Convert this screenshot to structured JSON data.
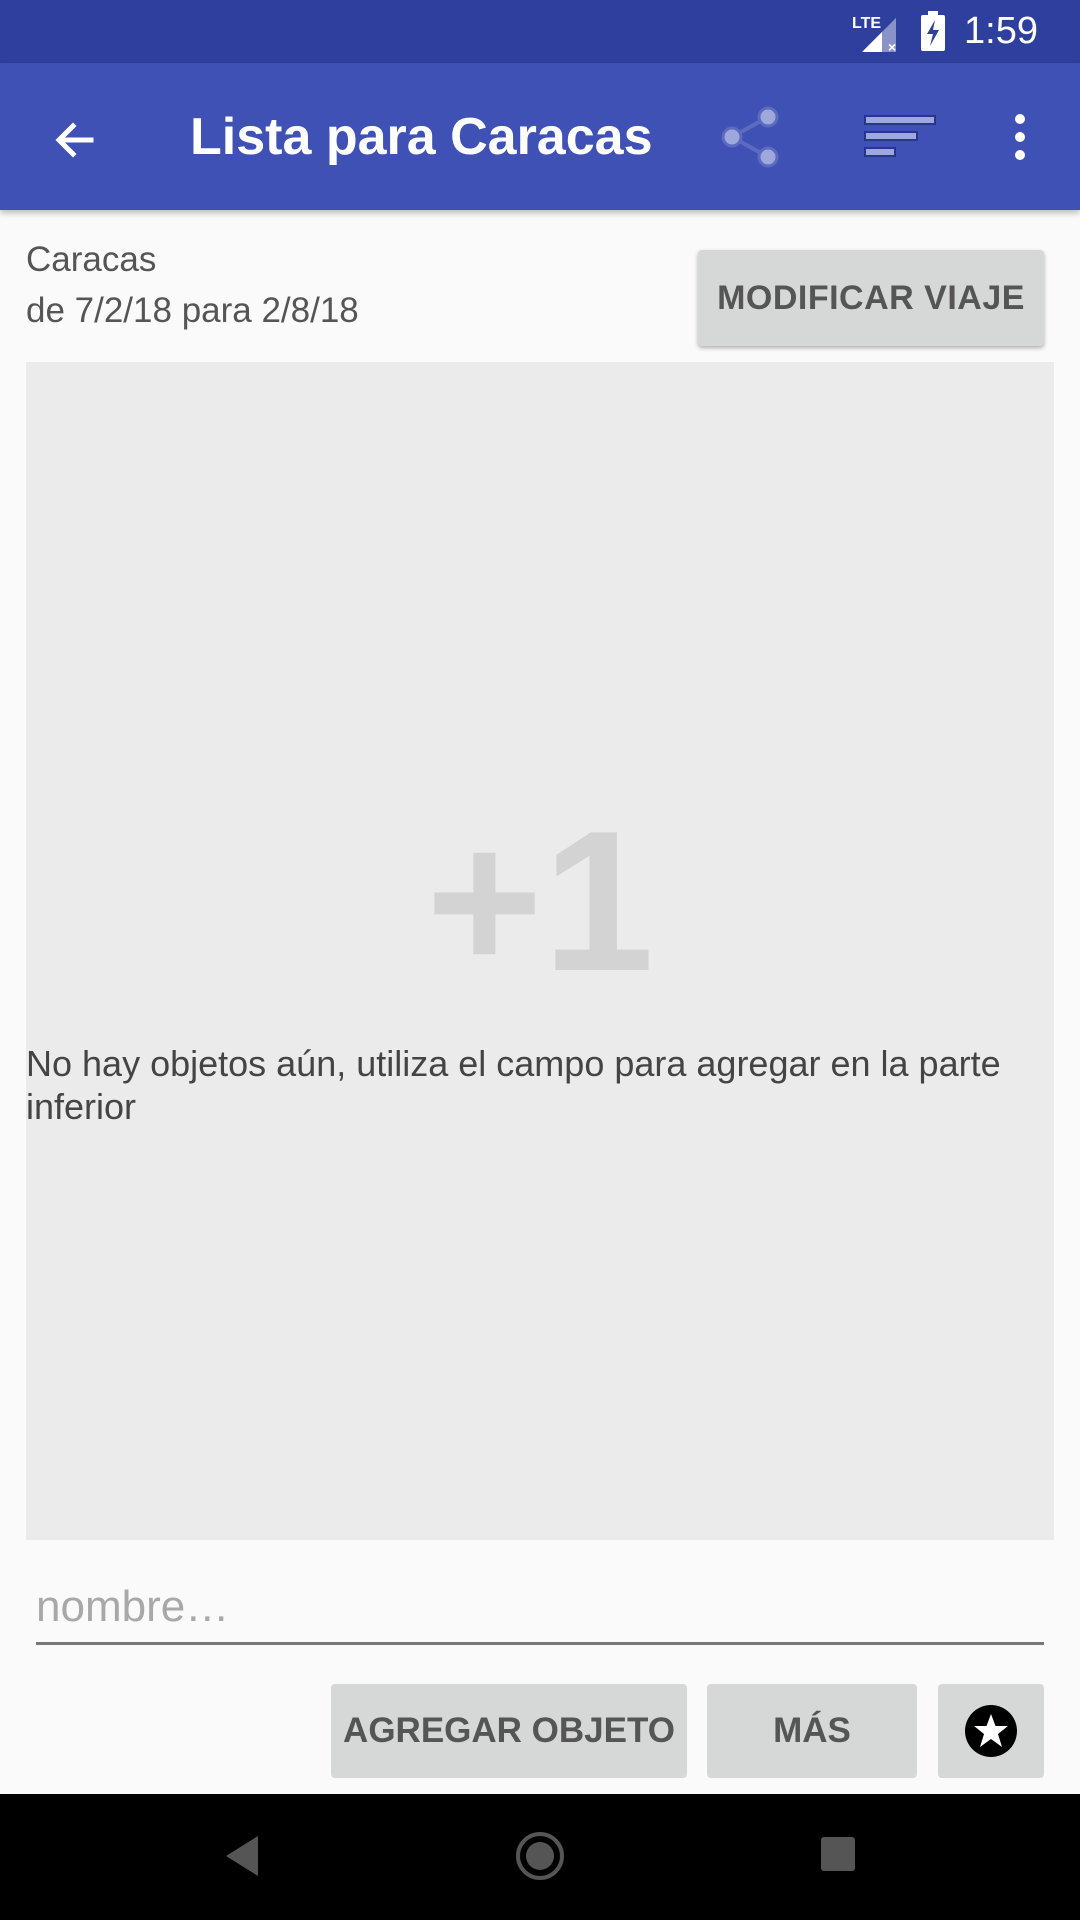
{
  "status_bar": {
    "time": "1:59",
    "network": "LTE",
    "icons": [
      "lte-signal-icon",
      "battery-charging-icon"
    ]
  },
  "app_bar": {
    "title": "Lista para Caracas",
    "icons": [
      "back-arrow-icon",
      "share-icon",
      "sort-icon",
      "more-vert-icon"
    ],
    "color": "#3f51b5"
  },
  "trip": {
    "name": "Caracas",
    "dates": "de 7/2/18 para 2/8/18",
    "modify_label": "MODIFICAR VIAJE"
  },
  "list": {
    "empty_icon_text": "+1",
    "empty_message": "No hay objetos aún, utiliza el campo para agregar en la parte inferior"
  },
  "input": {
    "placeholder": "nombre…",
    "value": ""
  },
  "actions": {
    "add_label": "AGREGAR OBJETO",
    "more_label": "MÁS",
    "favorite_icon": "star-circle-icon"
  },
  "nav_bar": {
    "icons": [
      "nav-back-icon",
      "nav-home-icon",
      "nav-recents-icon"
    ]
  }
}
